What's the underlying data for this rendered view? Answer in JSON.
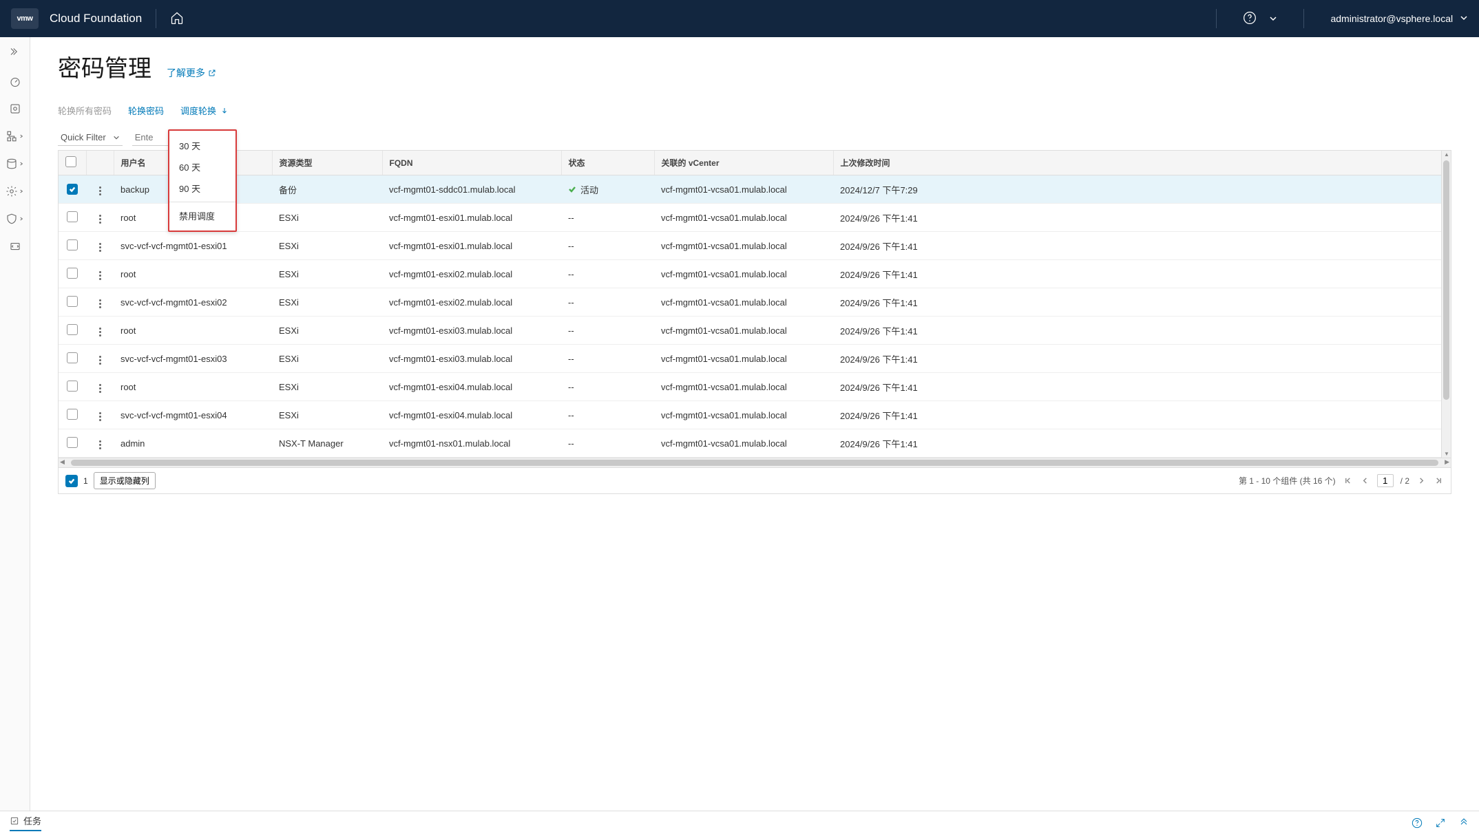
{
  "topbar": {
    "logo": "vmw",
    "title": "Cloud Foundation",
    "user": "administrator@vsphere.local"
  },
  "page": {
    "title": "密码管理",
    "learn_more": "了解更多"
  },
  "actions": {
    "rotate_all": "轮换所有密码",
    "rotate": "轮换密码",
    "schedule": "调度轮换"
  },
  "filter": {
    "quick": "Quick Filter",
    "placeholder": "Ente"
  },
  "dropdown": {
    "opt30": "30 天",
    "opt60": "60 天",
    "opt90": "90 天",
    "disable": "禁用调度"
  },
  "columns": {
    "user": "用户名",
    "restype": "资源类型",
    "fqdn": "FQDN",
    "status": "状态",
    "vcenter": "关联的 vCenter",
    "modified": "上次修改时间"
  },
  "rows": [
    {
      "checked": true,
      "user": "backup",
      "res": "备份",
      "fqdn": "vcf-mgmt01-sddc01.mulab.local",
      "status": "活动",
      "status_ok": true,
      "vc": "vcf-mgmt01-vcsa01.mulab.local",
      "time": "2024/12/7 下午7:29"
    },
    {
      "checked": false,
      "user": "root",
      "res": "ESXi",
      "fqdn": "vcf-mgmt01-esxi01.mulab.local",
      "status": "--",
      "status_ok": false,
      "vc": "vcf-mgmt01-vcsa01.mulab.local",
      "time": "2024/9/26 下午1:41"
    },
    {
      "checked": false,
      "user": "svc-vcf-vcf-mgmt01-esxi01",
      "res": "ESXi",
      "fqdn": "vcf-mgmt01-esxi01.mulab.local",
      "status": "--",
      "status_ok": false,
      "vc": "vcf-mgmt01-vcsa01.mulab.local",
      "time": "2024/9/26 下午1:41"
    },
    {
      "checked": false,
      "user": "root",
      "res": "ESXi",
      "fqdn": "vcf-mgmt01-esxi02.mulab.local",
      "status": "--",
      "status_ok": false,
      "vc": "vcf-mgmt01-vcsa01.mulab.local",
      "time": "2024/9/26 下午1:41"
    },
    {
      "checked": false,
      "user": "svc-vcf-vcf-mgmt01-esxi02",
      "res": "ESXi",
      "fqdn": "vcf-mgmt01-esxi02.mulab.local",
      "status": "--",
      "status_ok": false,
      "vc": "vcf-mgmt01-vcsa01.mulab.local",
      "time": "2024/9/26 下午1:41"
    },
    {
      "checked": false,
      "user": "root",
      "res": "ESXi",
      "fqdn": "vcf-mgmt01-esxi03.mulab.local",
      "status": "--",
      "status_ok": false,
      "vc": "vcf-mgmt01-vcsa01.mulab.local",
      "time": "2024/9/26 下午1:41"
    },
    {
      "checked": false,
      "user": "svc-vcf-vcf-mgmt01-esxi03",
      "res": "ESXi",
      "fqdn": "vcf-mgmt01-esxi03.mulab.local",
      "status": "--",
      "status_ok": false,
      "vc": "vcf-mgmt01-vcsa01.mulab.local",
      "time": "2024/9/26 下午1:41"
    },
    {
      "checked": false,
      "user": "root",
      "res": "ESXi",
      "fqdn": "vcf-mgmt01-esxi04.mulab.local",
      "status": "--",
      "status_ok": false,
      "vc": "vcf-mgmt01-vcsa01.mulab.local",
      "time": "2024/9/26 下午1:41"
    },
    {
      "checked": false,
      "user": "svc-vcf-vcf-mgmt01-esxi04",
      "res": "ESXi",
      "fqdn": "vcf-mgmt01-esxi04.mulab.local",
      "status": "--",
      "status_ok": false,
      "vc": "vcf-mgmt01-vcsa01.mulab.local",
      "time": "2024/9/26 下午1:41"
    },
    {
      "checked": false,
      "user": "admin",
      "res": "NSX-T Manager",
      "fqdn": "vcf-mgmt01-nsx01.mulab.local",
      "status": "--",
      "status_ok": false,
      "vc": "vcf-mgmt01-vcsa01.mulab.local",
      "time": "2024/9/26 下午1:41"
    }
  ],
  "footer": {
    "selected_count": "1",
    "col_toggle": "显示或隐藏列",
    "range": "第 1 - 10 个组件 (共 16 个)",
    "page": "1",
    "total_pages": "/ 2"
  },
  "bottombar": {
    "tasks": "任务"
  }
}
